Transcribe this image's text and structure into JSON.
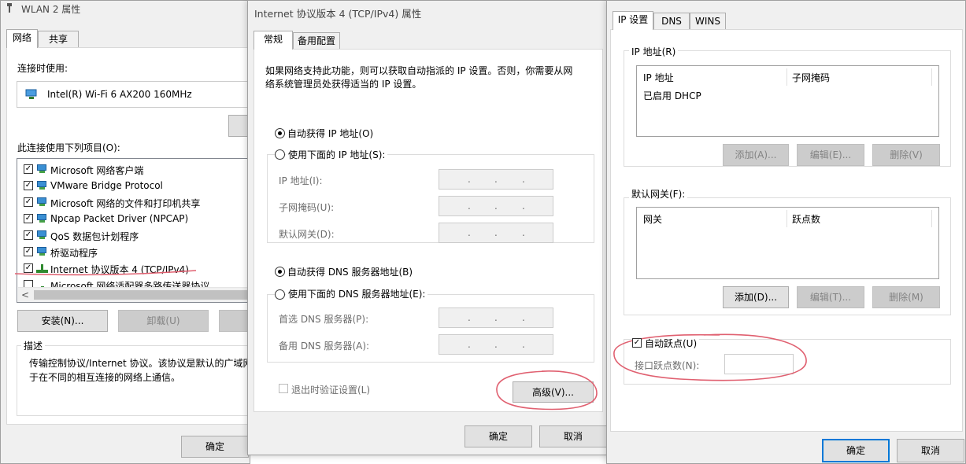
{
  "left_window": {
    "title": "WLAN 2 属性",
    "tabs": [
      "网络",
      "共享"
    ],
    "connect_using_label": "连接时使用:",
    "adapter_name": "Intel(R) Wi-Fi 6 AX200 160MHz",
    "items_label": "此连接使用下列项目(O):",
    "items": [
      {
        "label": "Microsoft 网络客户端",
        "checked": true
      },
      {
        "label": "VMware Bridge Protocol",
        "checked": true
      },
      {
        "label": "Microsoft 网络的文件和打印机共享",
        "checked": true
      },
      {
        "label": "Npcap Packet Driver (NPCAP)",
        "checked": true
      },
      {
        "label": "QoS 数据包计划程序",
        "checked": true
      },
      {
        "label": "桥驱动程序",
        "checked": true
      },
      {
        "label": "Internet 协议版本 4 (TCP/IPv4)",
        "checked": true
      },
      {
        "label": "Microsoft 网络适配器多路传送器协议",
        "checked": false
      }
    ],
    "scroll_left": "<",
    "install_button": "安装(N)...",
    "uninstall_button": "卸载(U)",
    "description_label": "描述",
    "description_text_1": "传输控制协议/Internet 协议。该协议是默认的广域网",
    "description_text_2": "于在不同的相互连接的网络上通信。",
    "ok_button": "确定"
  },
  "middle_window": {
    "title": "Internet 协议版本 4 (TCP/IPv4) 属性",
    "tabs": [
      "常规",
      "备用配置"
    ],
    "intro_1": "如果网络支持此功能，则可以获取自动指派的 IP 设置。否则，你需要从网",
    "intro_2": "络系统管理员处获得适当的 IP 设置。",
    "auto_ip": "自动获得 IP 地址(O)",
    "manual_ip": "使用下面的 IP 地址(S):",
    "ip_address_label": "IP 地址(I):",
    "subnet_label": "子网掩码(U):",
    "gateway_label": "默认网关(D):",
    "auto_dns": "自动获得 DNS 服务器地址(B)",
    "manual_dns": "使用下面的 DNS 服务器地址(E):",
    "preferred_dns_label": "首选 DNS 服务器(P):",
    "alternate_dns_label": "备用 DNS 服务器(A):",
    "ip_dot": ".",
    "validate_label": "退出时验证设置(L)",
    "advanced_button": "高级(V)...",
    "ok_button": "确定",
    "cancel_button": "取消"
  },
  "right_window": {
    "tabs": [
      "IP 设置",
      "DNS",
      "WINS"
    ],
    "ip_group_label": "IP 地址(R)",
    "ip_col1": "IP 地址",
    "ip_col2": "子网掩码",
    "ip_row1": "已启用 DHCP",
    "add_button": "添加(A)...",
    "edit_button": "编辑(E)...",
    "delete_button": "删除(V)",
    "gateway_group_label": "默认网关(F):",
    "gw_col1": "网关",
    "gw_col2": "跃点数",
    "gw_add_button": "添加(D)...",
    "gw_edit_button": "编辑(T)...",
    "gw_delete_button": "删除(M)",
    "auto_metric": "自动跃点(U)",
    "interface_metric_label": "接口跃点数(N):",
    "ok_button": "确定",
    "cancel_button": "取消"
  },
  "colors": {
    "annotation_red": "#e06070",
    "focus_blue": "#0078d7"
  }
}
